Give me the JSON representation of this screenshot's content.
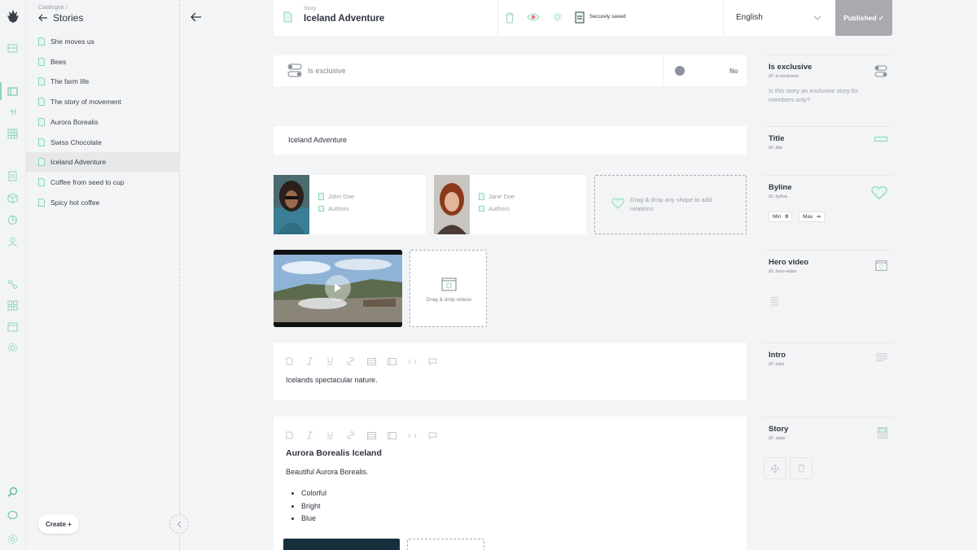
{
  "colors": {
    "accent": "#8cd5c0",
    "published_bg": "#a8aaae"
  },
  "tree": {
    "breadcrumb": "Catalogue /",
    "title": "Stories",
    "items": [
      {
        "label": "She moves us",
        "selected": false
      },
      {
        "label": "Bees",
        "selected": false
      },
      {
        "label": "The farm life",
        "selected": false
      },
      {
        "label": "The story of movement",
        "selected": false
      },
      {
        "label": "Aurora Borealis",
        "selected": false
      },
      {
        "label": "Swiss Chocolate",
        "selected": false
      },
      {
        "label": "Iceland Adventure",
        "selected": true
      },
      {
        "label": "Coffee from seed to cup",
        "selected": false
      },
      {
        "label": "Spicy hot coffee",
        "selected": false
      }
    ],
    "create_label": "Create +"
  },
  "topbar": {
    "type_label": "Story",
    "title": "Iceland Adventure",
    "save_status": "Securely saved",
    "language": "English",
    "publish_status": "Published ✓"
  },
  "fields": {
    "is_exclusive": {
      "label": "Is exclusive",
      "value": "No"
    },
    "title_value": "Iceland Adventure",
    "byline": {
      "people": [
        {
          "name": "John Doe",
          "role": "Authors"
        },
        {
          "name": "Jane Doe",
          "role": "Authors"
        }
      ],
      "drop_hint": "Drag & drop any shape to add relations"
    },
    "video": {
      "drop_hint": "Drag & drop videos"
    },
    "intro_text": "Icelands spectacular nature.",
    "story": {
      "heading": "Aurora Borealis Iceland",
      "paragraph": "Beautiful Aurora Borealis.",
      "bullets": [
        "Colorful",
        "Bright",
        "Blue"
      ]
    }
  },
  "right_panel": {
    "is_exclusive": {
      "name": "Is exclusive",
      "id": "ID: is-exclusive",
      "description": "Is this story an exclusive story for members only?"
    },
    "title": {
      "name": "Title",
      "id": "ID: title"
    },
    "byline": {
      "name": "Byline",
      "id": "ID: byline",
      "min_label": "Min",
      "min_value": "0",
      "max_label": "Max",
      "max_value": "∞"
    },
    "hero_video": {
      "name": "Hero video",
      "id": "ID: hero-video"
    },
    "intro": {
      "name": "Intro",
      "id": "ID: intro"
    },
    "story": {
      "name": "Story",
      "id": "ID: story"
    }
  },
  "icons": [
    "logo-icon",
    "catalogue-icon",
    "stories-icon",
    "tree-icon",
    "grid-icon",
    "document-icon",
    "cube-icon",
    "pie-chart-icon",
    "user-icon",
    "git-icon",
    "apps-icon",
    "calendar-icon",
    "settings-icon",
    "search-icon",
    "chat-icon",
    "gear-icon"
  ]
}
